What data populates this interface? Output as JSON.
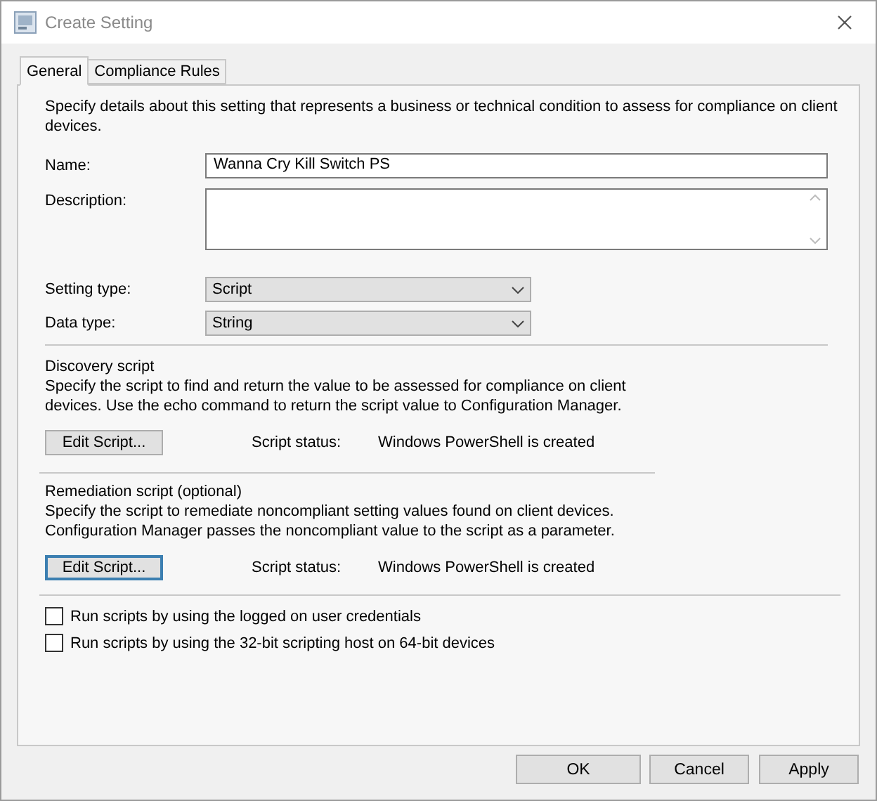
{
  "window": {
    "title": "Create Setting"
  },
  "tabs": [
    {
      "label": "General",
      "selected": true
    },
    {
      "label": "Compliance Rules",
      "selected": false
    }
  ],
  "intro": "Specify details about this setting that represents a business or technical condition to assess for compliance on client devices.",
  "fields": [
    {
      "kind": "text",
      "label": "Name:",
      "value": "Wanna Cry Kill Switch PS"
    },
    {
      "kind": "multiline",
      "label": "Description:"
    },
    {
      "kind": "dropdown",
      "label": "Setting type:",
      "value": "Script"
    },
    {
      "kind": "dropdown",
      "label": "Data type:",
      "value": "String"
    }
  ],
  "scripts": [
    {
      "title": "Discovery script",
      "description": "Specify the script to find and return the value to be assessed for compliance on client devices. Use the echo command to return the script value to Configuration Manager.",
      "button": {
        "label": "Edit Script...",
        "focused": false
      },
      "status_label": "Script status:",
      "status": "Windows PowerShell is created"
    },
    {
      "title": "Remediation script (optional)",
      "description": "Specify the script to remediate noncompliant setting values found on client devices. Configuration Manager passes the noncompliant value to the script as a parameter.",
      "button": {
        "label": "Edit Script...",
        "focused": true
      },
      "status_label": "Script status:",
      "status": "Windows PowerShell is created"
    }
  ],
  "options": [
    {
      "label": "Run scripts by using the logged on user credentials",
      "checked": false
    },
    {
      "label": "Run scripts by using the 32-bit scripting host on 64-bit devices",
      "checked": false
    }
  ],
  "buttons": [
    "OK",
    "Cancel",
    "Apply"
  ]
}
